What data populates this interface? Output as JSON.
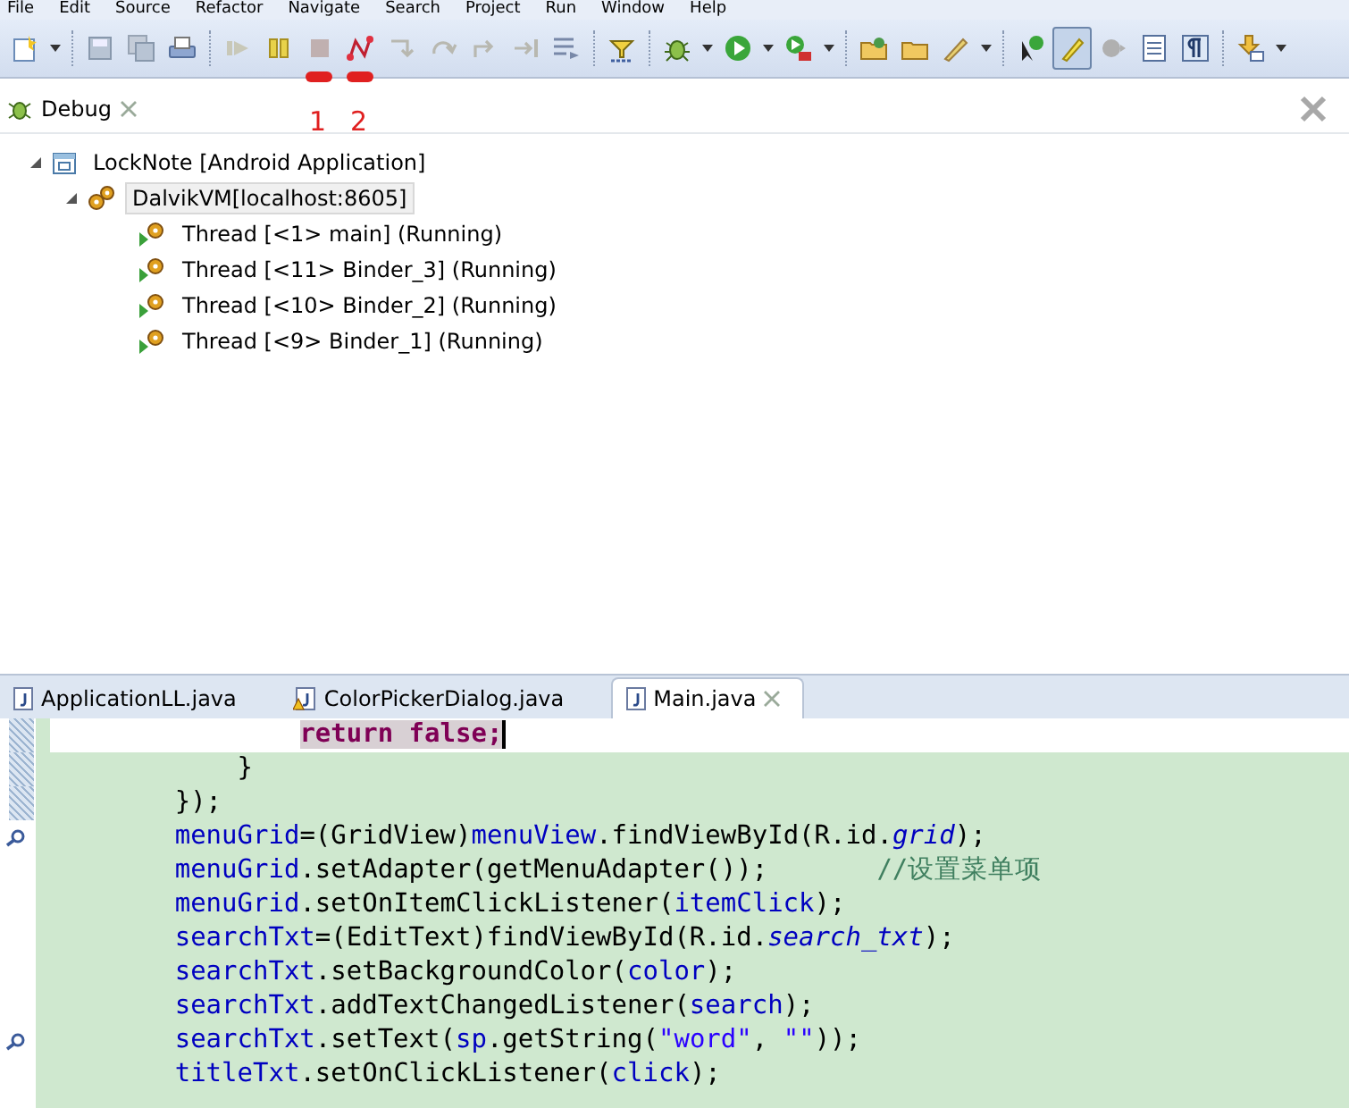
{
  "menu_bar": [
    "File",
    "Edit",
    "Source",
    "Refactor",
    "Navigate",
    "Search",
    "Project",
    "Run",
    "Window",
    "Help"
  ],
  "toolbar": {
    "annotations": [
      {
        "label": "1",
        "color": "#e02020"
      },
      {
        "label": "2",
        "color": "#e02020"
      }
    ],
    "pressed_tool_selected": true
  },
  "debug_view": {
    "tab": {
      "label": "Debug"
    },
    "tree": [
      {
        "label": "LockNote [Android Application]",
        "kind": "app",
        "expanded": true,
        "selected": false,
        "children": [
          {
            "label": "DalvikVM[localhost:8605]",
            "kind": "vm",
            "expanded": true,
            "selected": true,
            "children": [
              {
                "label": "Thread [<1> main] (Running)",
                "kind": "thread",
                "selected": false
              },
              {
                "label": "Thread [<11> Binder_3] (Running)",
                "kind": "thread",
                "selected": false
              },
              {
                "label": "Thread [<10> Binder_2] (Running)",
                "kind": "thread",
                "selected": false
              },
              {
                "label": "Thread [<9> Binder_1] (Running)",
                "kind": "thread",
                "selected": false
              }
            ]
          }
        ]
      }
    ]
  },
  "editor": {
    "tabs": [
      {
        "label": "ApplicationLL.java",
        "warning": false,
        "selected": false
      },
      {
        "label": "ColorPickerDialog.java",
        "warning": true,
        "selected": false
      },
      {
        "label": "Main.java",
        "warning": false,
        "selected": true
      }
    ],
    "lines": [
      {
        "current": true,
        "changed": true,
        "marker": false,
        "tokens": [
          {
            "text": "                return false;",
            "kind": "keyword"
          }
        ]
      },
      {
        "current": false,
        "changed": true,
        "marker": false,
        "tokens": [
          {
            "text": "            }",
            "kind": "plain"
          }
        ]
      },
      {
        "current": false,
        "changed": true,
        "marker": false,
        "tokens": [
          {
            "text": "        });",
            "kind": "plain"
          }
        ]
      },
      {
        "current": false,
        "changed": false,
        "marker": true,
        "tokens": [
          {
            "text": "        menuGrid",
            "kind": "field"
          },
          {
            "text": "=(GridView)",
            "kind": "plain"
          },
          {
            "text": "menuView",
            "kind": "field"
          },
          {
            "text": ".findViewById(R.id.",
            "kind": "plain"
          },
          {
            "text": "grid",
            "kind": "static"
          },
          {
            "text": ");",
            "kind": "plain"
          }
        ]
      },
      {
        "current": false,
        "changed": false,
        "marker": false,
        "tokens": [
          {
            "text": "        menuGrid",
            "kind": "field"
          },
          {
            "text": ".setAdapter(getMenuAdapter());       ",
            "kind": "plain"
          },
          {
            "text": "//设置菜单项",
            "kind": "comment"
          }
        ]
      },
      {
        "current": false,
        "changed": false,
        "marker": false,
        "tokens": [
          {
            "text": "        menuGrid",
            "kind": "field"
          },
          {
            "text": ".setOnItemClickListener(",
            "kind": "plain"
          },
          {
            "text": "itemClick",
            "kind": "field"
          },
          {
            "text": ");",
            "kind": "plain"
          }
        ]
      },
      {
        "current": false,
        "changed": false,
        "marker": false,
        "tokens": [
          {
            "text": "        searchTxt",
            "kind": "field"
          },
          {
            "text": "=(EditText)findViewById(R.id.",
            "kind": "plain"
          },
          {
            "text": "search_txt",
            "kind": "static"
          },
          {
            "text": ");",
            "kind": "plain"
          }
        ]
      },
      {
        "current": false,
        "changed": false,
        "marker": false,
        "tokens": [
          {
            "text": "        searchTxt",
            "kind": "field"
          },
          {
            "text": ".setBackgroundColor(",
            "kind": "plain"
          },
          {
            "text": "color",
            "kind": "field"
          },
          {
            "text": ");",
            "kind": "plain"
          }
        ]
      },
      {
        "current": false,
        "changed": false,
        "marker": false,
        "tokens": [
          {
            "text": "        searchTxt",
            "kind": "field"
          },
          {
            "text": ".addTextChangedListener(",
            "kind": "plain"
          },
          {
            "text": "search",
            "kind": "field"
          },
          {
            "text": ");",
            "kind": "plain"
          }
        ]
      },
      {
        "current": false,
        "changed": false,
        "marker": true,
        "tokens": [
          {
            "text": "        searchTxt",
            "kind": "field"
          },
          {
            "text": ".setText(",
            "kind": "plain"
          },
          {
            "text": "sp",
            "kind": "field"
          },
          {
            "text": ".getString(",
            "kind": "plain"
          },
          {
            "text": "\"word\"",
            "kind": "string"
          },
          {
            "text": ", ",
            "kind": "plain"
          },
          {
            "text": "\"\"",
            "kind": "string"
          },
          {
            "text": "));",
            "kind": "plain"
          }
        ]
      },
      {
        "current": false,
        "changed": false,
        "marker": false,
        "tokens": [
          {
            "text": "        titleTxt",
            "kind": "field"
          },
          {
            "text": ".setOnClickListener(",
            "kind": "plain"
          },
          {
            "text": "click",
            "kind": "field"
          },
          {
            "text": ");",
            "kind": "plain"
          }
        ]
      }
    ]
  }
}
